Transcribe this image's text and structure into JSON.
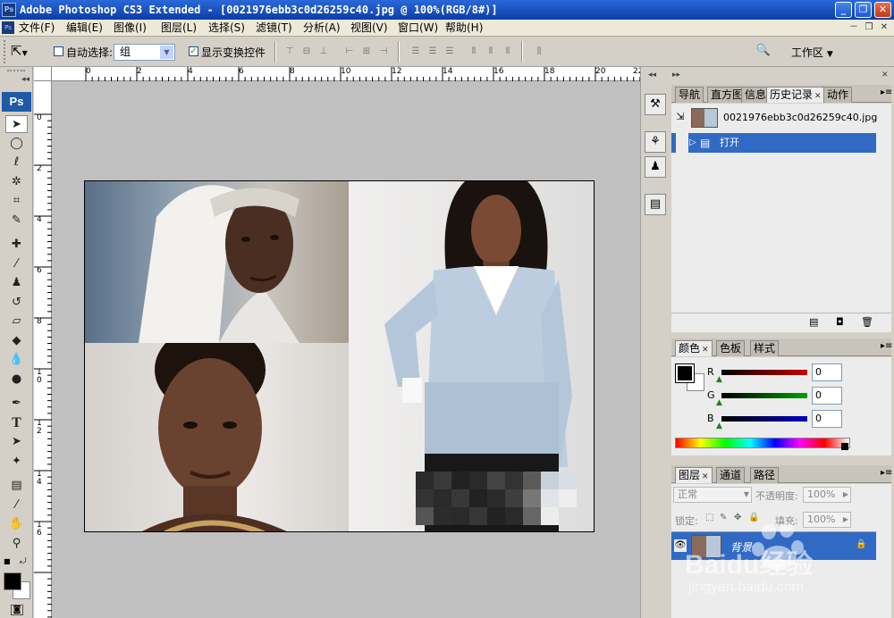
{
  "window": {
    "title": "Adobe Photoshop CS3 Extended - [0021976ebb3c0d26259c40.jpg @ 100%(RGB/8#)]",
    "app_icon": "Ps",
    "minimize_icon": "minimize-icon",
    "maximize_icon": "maximize-icon",
    "close_icon": "close-icon"
  },
  "menu": {
    "items": [
      "文件(F)",
      "编辑(E)",
      "图像(I)",
      "图层(L)",
      "选择(S)",
      "滤镜(T)",
      "分析(A)",
      "视图(V)",
      "窗口(W)",
      "帮助(H)"
    ],
    "doc_controls": [
      "－",
      "❐",
      "✕"
    ]
  },
  "options": {
    "auto_select_label": "自动选择:",
    "auto_select_checked": false,
    "auto_select_value": "组",
    "show_transform_label": "显示变换控件",
    "show_transform_checked": true,
    "workspace_label": "工作区"
  },
  "toolbox": {
    "logo": "Ps",
    "tools": [
      "move-tool",
      "marquee-tool",
      "lasso-tool",
      "magic-wand-tool",
      "crop-tool",
      "slice-tool",
      "healing-brush-tool",
      "brush-tool",
      "clone-stamp-tool",
      "history-brush-tool",
      "eraser-tool",
      "paint-bucket-tool",
      "blur-tool",
      "dodge-tool",
      "pen-tool",
      "type-tool",
      "path-selection-tool",
      "shape-tool",
      "notes-tool",
      "eyedropper-tool",
      "hand-tool",
      "zoom-tool"
    ],
    "foreground_color": "#000000",
    "background_color": "#ffffff"
  },
  "rulers": {
    "top_labels": [
      "0",
      "2",
      "4",
      "6",
      "8",
      "10",
      "12",
      "14",
      "16",
      "18",
      "20",
      "22"
    ],
    "left_labels": [
      "0",
      "2",
      "4",
      "6",
      "8",
      "10",
      "12",
      "14",
      "16"
    ]
  },
  "panels": {
    "history": {
      "tabs": [
        "导航",
        "直方图",
        "信息",
        "历史记录",
        "动作"
      ],
      "active_tab": "历史记录",
      "snapshot_name": "0021976ebb3c0d26259c40.jpg",
      "states": [
        "打开"
      ]
    },
    "color": {
      "tabs": [
        "颜色",
        "色板",
        "样式"
      ],
      "active_tab": "颜色",
      "channels": [
        {
          "label": "R",
          "value": "0",
          "color": "#c80000"
        },
        {
          "label": "G",
          "value": "0",
          "color": "#00a000"
        },
        {
          "label": "B",
          "value": "0",
          "color": "#0000c0"
        }
      ]
    },
    "layers": {
      "tabs": [
        "图层",
        "通道",
        "路径"
      ],
      "active_tab": "图层",
      "blend_mode": "正常",
      "opacity_label": "不透明度:",
      "opacity_value": "100%",
      "lock_label": "锁定:",
      "fill_label": "填充:",
      "fill_value": "100%",
      "layer_name": "背景"
    }
  },
  "watermark": {
    "brand": "Baidu经验",
    "url": "jingyan.baidu.com"
  }
}
